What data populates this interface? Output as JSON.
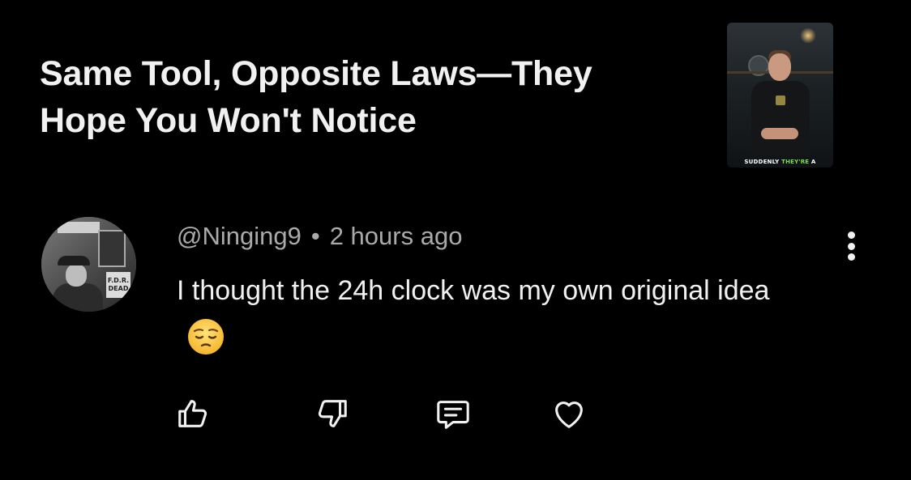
{
  "video": {
    "title": "Same Tool, Opposite Laws—They Hope You Won't Notice",
    "thumbnail_caption_prefix": "SUDDENLY ",
    "thumbnail_caption_highlight": "THEY'RE",
    "thumbnail_caption_suffix": " A"
  },
  "comment": {
    "author": "@Ninging9",
    "separator": "•",
    "time": "2 hours ago",
    "text": "I thought the 24h clock was my own original idea",
    "emoji": "pensive-face",
    "avatar_sign_text": "F.D.R. DEAD"
  },
  "actions": {
    "like_icon": "thumbs-up-icon",
    "dislike_icon": "thumbs-down-icon",
    "reply_icon": "reply-comment-icon",
    "heart_icon": "heart-icon",
    "more_icon": "more-vertical-icon"
  },
  "colors": {
    "background": "#000000",
    "primary_text": "#f1f1f1",
    "secondary_text": "#aaaaaa",
    "thumb_highlight": "#7be04a"
  }
}
